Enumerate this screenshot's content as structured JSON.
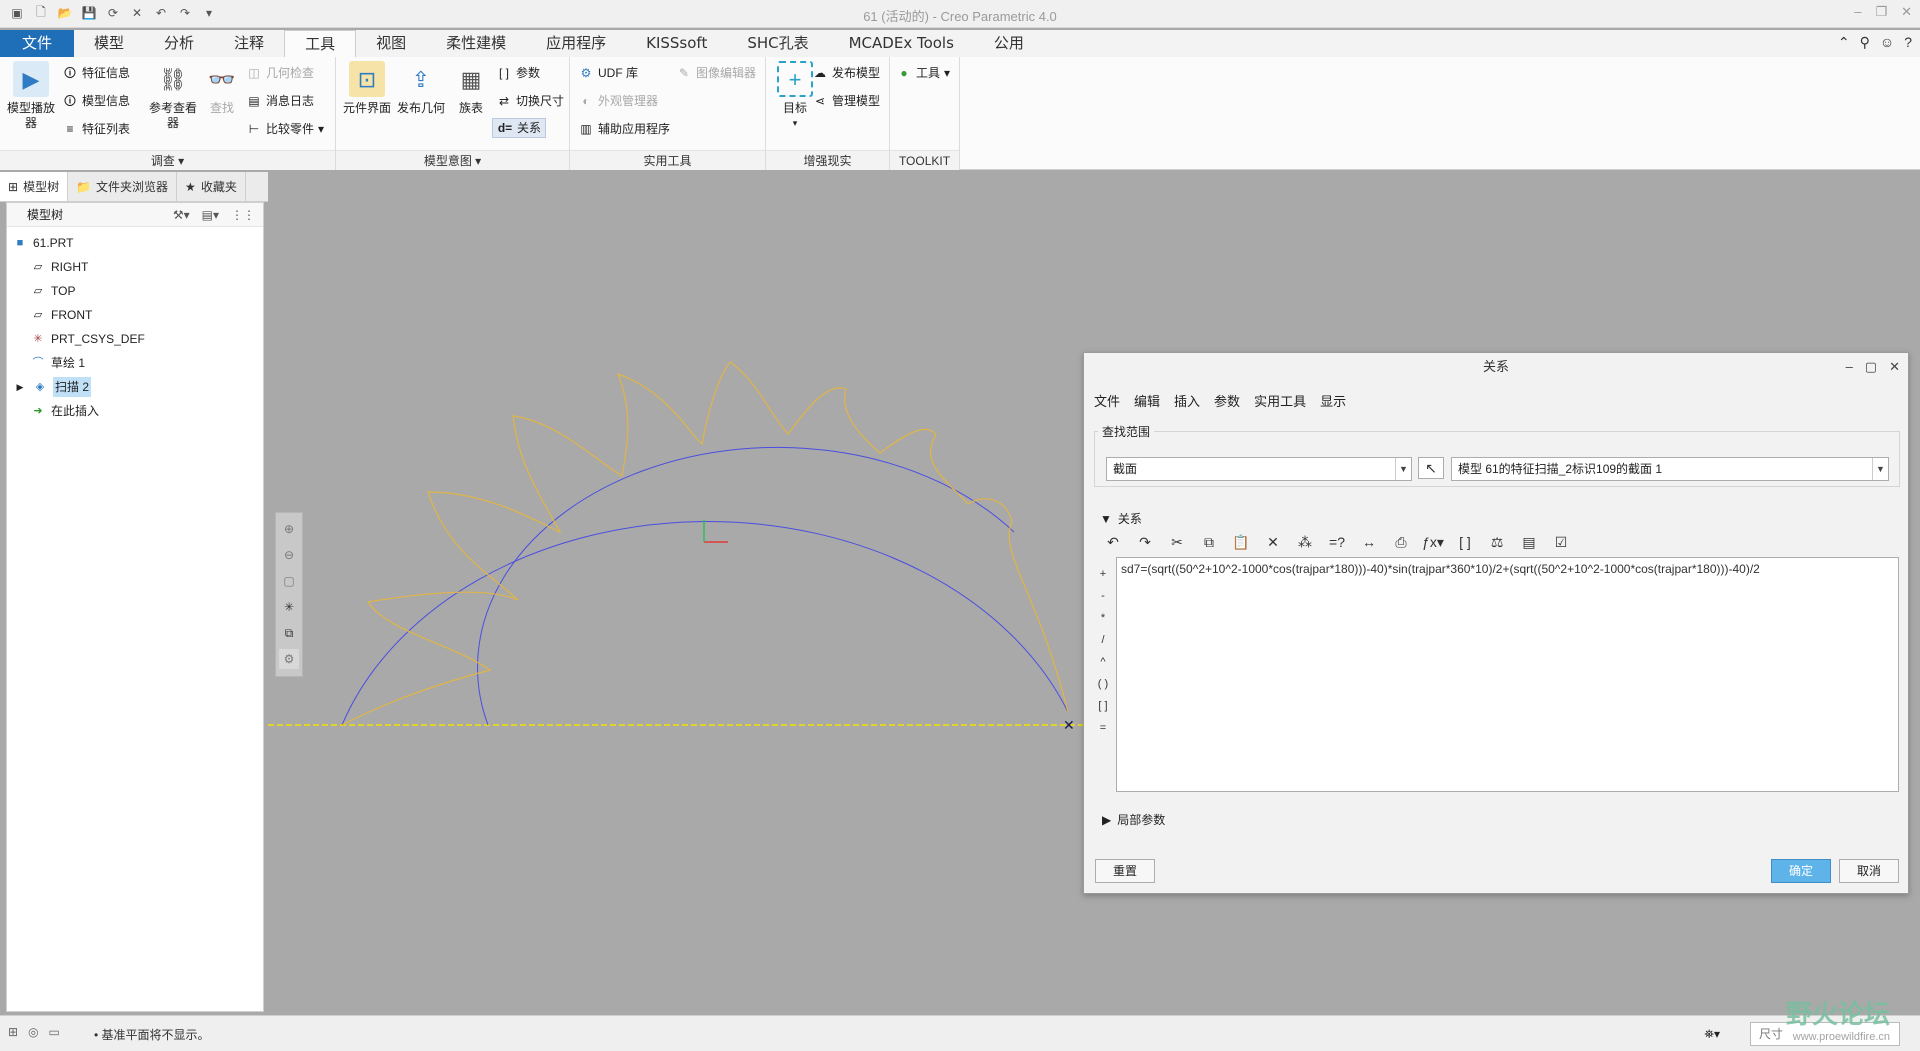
{
  "window": {
    "title": "61 (活动的) - Creo Parametric 4.0",
    "quick_access_icons": [
      "app-icon",
      "new-icon",
      "open-icon",
      "save-icon",
      "regenerate-icon",
      "close-window-icon",
      "undo-icon",
      "redo-icon",
      "customize-icon"
    ]
  },
  "tabs": {
    "items": [
      "文件",
      "模型",
      "分析",
      "注释",
      "工具",
      "视图",
      "柔性建模",
      "应用程序",
      "KISSsoft",
      "SHC孔表",
      "MCADEx Tools",
      "公用"
    ],
    "active": "工具"
  },
  "ribbon": {
    "investigate": {
      "model_player": "模型播放器",
      "feature_info": "特征信息",
      "model_info": "模型信息",
      "feature_list": "特征列表",
      "ref_viewer": "参考查看器",
      "find": "查找",
      "geom_check": "几何检查",
      "msg_log": "消息日志",
      "compare_part": "比较零件",
      "label": "调查"
    },
    "model_intent": {
      "component_interface": "元件界面",
      "publish_geometry": "发布几何",
      "family_table": "族表",
      "parameters": "参数",
      "switch_dims": "切换尺寸",
      "relations": "关系",
      "label": "模型意图"
    },
    "utilities": {
      "udf_lib": "UDF 库",
      "appearance_mgr": "外观管理器",
      "aux_apps": "辅助应用程序",
      "image_editor": "图像编辑器",
      "label": "实用工具"
    },
    "ar": {
      "target": "目标",
      "publish_model": "发布模型",
      "manage_model": "管理模型",
      "label": "增强现实"
    },
    "toolkit": {
      "tools": "工具",
      "label": "TOOLKIT"
    }
  },
  "left_panel": {
    "tabs": [
      "模型树",
      "文件夹浏览器",
      "收藏夹"
    ],
    "tree_header": "模型树",
    "items": [
      {
        "label": "61.PRT",
        "icon": "part-icon"
      },
      {
        "label": "RIGHT",
        "icon": "datum-plane-icon"
      },
      {
        "label": "TOP",
        "icon": "datum-plane-icon"
      },
      {
        "label": "FRONT",
        "icon": "datum-plane-icon"
      },
      {
        "label": "PRT_CSYS_DEF",
        "icon": "csys-icon"
      },
      {
        "label": "草绘 1",
        "icon": "sketch-icon"
      },
      {
        "label": "扫描 2",
        "icon": "sweep-icon"
      },
      {
        "label": "在此插入",
        "icon": "insert-here-icon"
      }
    ]
  },
  "dialog": {
    "title": "关系",
    "menu": [
      "文件",
      "编辑",
      "插入",
      "参数",
      "实用工具",
      "显示"
    ],
    "scope_label": "查找范围",
    "scope_value": "截面",
    "model_ref": "模型 61的特征扫描_2标识109的截面 1",
    "relations_header": "关系",
    "side_ops": [
      "+",
      "-",
      "*",
      "/",
      "^",
      "( )",
      "[ ]",
      "="
    ],
    "relation_text": "sd7=(sqrt((50^2+10^2-1000*cos(trajpar*180)))-40)*sin(trajpar*360*10)/2+(sqrt((50^2+10^2-1000*cos(trajpar*180)))-40)/2",
    "local_params": "局部参数",
    "reset": "重置",
    "ok": "确定",
    "cancel": "取消"
  },
  "status": {
    "message": "• 基准平面将不显示。",
    "filter": "尺寸"
  },
  "watermark": {
    "title": "野火论坛",
    "url": "www.proewildfire.cn"
  },
  "colors": {
    "file_tab": "#1e6eb8",
    "curve_blue": "#4a4ee0",
    "sweep_yellow": "#e0b548",
    "baseline_yellow": "#f2e200",
    "ok_button": "#5eb4e8"
  }
}
